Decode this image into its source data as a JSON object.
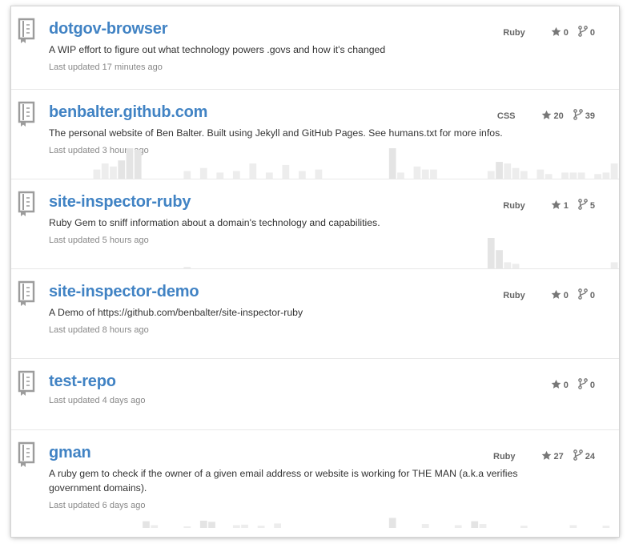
{
  "colors": {
    "link": "#4183c4",
    "text": "#333333",
    "muted": "#888888",
    "stat_text": "#666666",
    "icon": "#9c9c9c",
    "bar": "#e4e4e4",
    "bar_light": "#ededed"
  },
  "icons": {
    "repo": "repo-book-icon",
    "star": "star-icon",
    "fork": "fork-icon"
  },
  "repos": [
    {
      "name": "dotgov-browser",
      "description": "A WIP effort to figure out what technology powers .govs and how it's changed",
      "updated": "Last updated 17 minutes ago",
      "language": "Ruby",
      "stars": "0",
      "forks": "0",
      "activity": []
    },
    {
      "name": "benbalter.github.com",
      "description": "The personal website of Ben Balter. Built using Jekyll and GitHub Pages. See humans.txt for more infos.",
      "updated": "Last updated 3 hours ago",
      "language": "CSS",
      "stars": "20",
      "forks": "39",
      "activity": [
        0,
        0,
        0,
        0,
        0,
        0,
        0,
        0,
        0,
        0,
        0.3,
        0.5,
        0.4,
        0.6,
        1,
        0.95,
        0,
        0,
        0,
        0,
        0,
        0.25,
        0,
        0.35,
        0,
        0.2,
        0,
        0.25,
        0,
        0.5,
        0,
        0.2,
        0,
        0.45,
        0,
        0.25,
        0,
        0.3,
        0,
        0,
        0,
        0,
        0,
        0,
        0,
        0,
        1,
        0.2,
        0,
        0.4,
        0.3,
        0.3,
        0,
        0,
        0,
        0,
        0,
        0,
        0.25,
        0.55,
        0.5,
        0.35,
        0.25,
        0,
        0.3,
        0.15,
        0,
        0.2,
        0.2,
        0.2,
        0,
        0.15,
        0.2,
        0.5
      ]
    },
    {
      "name": "site-inspector-ruby",
      "description": "Ruby Gem to sniff information about a domain's technology and capabilities.",
      "updated": "Last updated 5 hours ago",
      "language": "Ruby",
      "stars": "1",
      "forks": "5",
      "activity": [
        0,
        0,
        0,
        0,
        0,
        0,
        0,
        0,
        0,
        0,
        0,
        0,
        0,
        0,
        0,
        0,
        0,
        0,
        0,
        0,
        0,
        0.05,
        0,
        0,
        0,
        0,
        0,
        0,
        0,
        0,
        0,
        0,
        0,
        0,
        0,
        0,
        0,
        0,
        0,
        0,
        0,
        0,
        0,
        0,
        0,
        0,
        0,
        0,
        0,
        0,
        0,
        0,
        0,
        0,
        0,
        0,
        0,
        0,
        1,
        0.6,
        0.2,
        0.15,
        0,
        0,
        0,
        0,
        0,
        0,
        0,
        0,
        0,
        0,
        0,
        0.2
      ]
    },
    {
      "name": "site-inspector-demo",
      "description": "A Demo of https://github.com/benbalter/site-inspector-ruby",
      "updated": "Last updated 8 hours ago",
      "language": "Ruby",
      "stars": "0",
      "forks": "0",
      "activity": []
    },
    {
      "name": "test-repo",
      "description": "",
      "updated": "Last updated 4 days ago",
      "language": "",
      "stars": "0",
      "forks": "0",
      "activity": []
    },
    {
      "name": "gman",
      "description": "A ruby gem to check if the owner of a given email address or website is working for THE MAN (a.k.a verifies government domains).",
      "updated": "Last updated 6 days ago",
      "language": "Ruby",
      "stars": "27",
      "forks": "24",
      "activity": [
        0,
        0,
        0,
        0,
        0,
        0,
        0,
        0,
        0,
        0,
        0,
        0,
        0,
        0,
        0,
        0,
        0.6,
        0.25,
        0,
        0,
        0,
        0.15,
        0,
        0.65,
        0.55,
        0,
        0,
        0.25,
        0.3,
        0,
        0.2,
        0,
        0.4,
        0,
        0,
        0,
        0,
        0,
        0,
        0,
        0,
        0,
        0,
        0,
        0,
        0,
        0.9,
        0,
        0,
        0,
        0.35,
        0,
        0,
        0,
        0.25,
        0,
        0.6,
        0.35,
        0,
        0,
        0,
        0,
        0.2,
        0,
        0,
        0,
        0,
        0,
        0.25,
        0,
        0,
        0,
        0.2,
        0
      ]
    }
  ]
}
